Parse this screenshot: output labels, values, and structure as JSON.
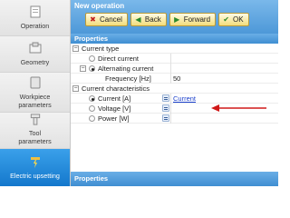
{
  "sidebar": {
    "items": [
      {
        "label": "Operation"
      },
      {
        "label": "Geometry"
      },
      {
        "label": "Workpiece parameters"
      },
      {
        "label": "Tool parameters"
      },
      {
        "label": "Electric upsetting",
        "active": true
      }
    ]
  },
  "header": {
    "title": "New operation",
    "buttons": {
      "cancel": "Cancel",
      "back": "Back",
      "forward": "Forward",
      "ok": "OK"
    }
  },
  "properties": {
    "header": "Properties",
    "current_type": {
      "label": "Current type",
      "options": {
        "direct": "Direct current",
        "alternating": "Alternating current"
      },
      "frequency": {
        "label": "Frequency [Hz]",
        "value": "50"
      }
    },
    "current_characteristics": {
      "label": "Current characteristics",
      "current": {
        "label": "Current [A]",
        "value": "Current"
      },
      "voltage": {
        "label": "Voltage [V]"
      },
      "power": {
        "label": "Power [W]"
      }
    }
  },
  "bottom_panel": {
    "header": "Properties"
  },
  "colors": {
    "accent_blue": "#3f8ed2",
    "active_tab": "#1478cc",
    "button_yellow": "#f3dd7a",
    "annotation_red": "#d01818",
    "link": "#1a3fcc"
  }
}
